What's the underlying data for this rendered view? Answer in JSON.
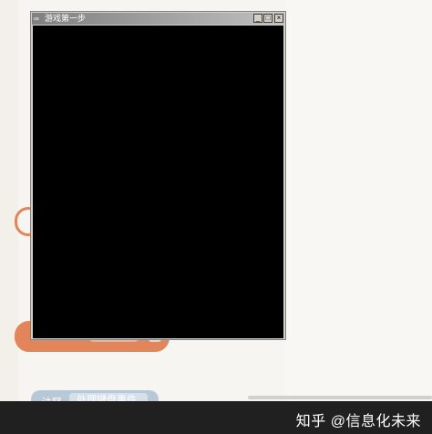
{
  "window": {
    "title": "游戏第一步",
    "minimize_glyph": "_",
    "maximize_glyph": "□",
    "close_glyph": "×"
  },
  "background": {
    "comment_label": "注释",
    "comment_value": "处理键盘事件"
  },
  "watermark": {
    "text": "知乎 @信息化未来"
  }
}
